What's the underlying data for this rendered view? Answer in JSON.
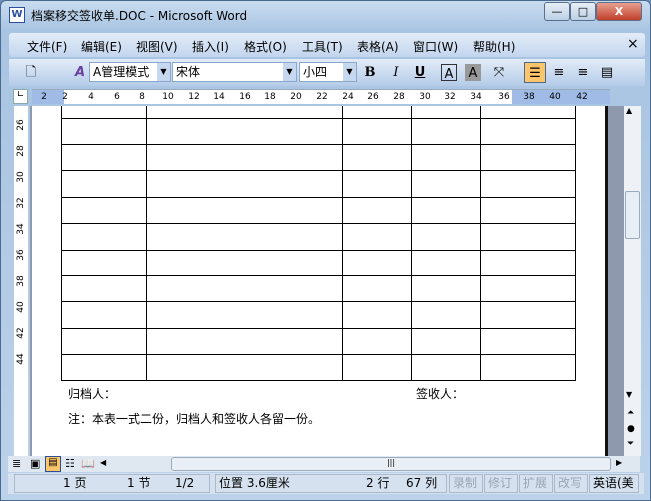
{
  "window": {
    "title": "档案移交签收单.DOC - Microsoft Word",
    "minimize": "—",
    "maximize": "□",
    "close": "X"
  },
  "menu": [
    "文件(F)",
    "编辑(E)",
    "视图(V)",
    "插入(I)",
    "格式(O)",
    "工具(T)",
    "表格(A)",
    "窗口(W)",
    "帮助(H)"
  ],
  "menu_close": "×",
  "toolbar": {
    "style": "A管理模式",
    "font": "宋体",
    "size": "小四",
    "bold": "B",
    "italic": "I",
    "underline": "U",
    "char_border": "A",
    "char_shade": "A"
  },
  "ruler": {
    "h": [
      "2",
      "2",
      "4",
      "6",
      "8",
      "10",
      "12",
      "14",
      "16",
      "18",
      "20",
      "22",
      "24",
      "26",
      "28",
      "30",
      "32",
      "34",
      "36",
      "38",
      "40",
      "42"
    ],
    "v": [
      "26",
      "28",
      "30",
      "32",
      "34",
      "36",
      "38",
      "40",
      "42",
      "44"
    ]
  },
  "document": {
    "archiver": "归档人：",
    "receiver": "签收人：",
    "note": "注：本表一式二份，归档人和签收人各留一份。",
    "table_rows": 10,
    "table_cols": 5
  },
  "status": {
    "page": "1 页",
    "section": "1 节",
    "pages": "1/2",
    "position": "位置 3.6厘米",
    "line": "2 行",
    "col": "67 列",
    "rec": "录制",
    "trk": "修订",
    "ext": "扩展",
    "ovr": "改写",
    "lang": "英语(美"
  }
}
